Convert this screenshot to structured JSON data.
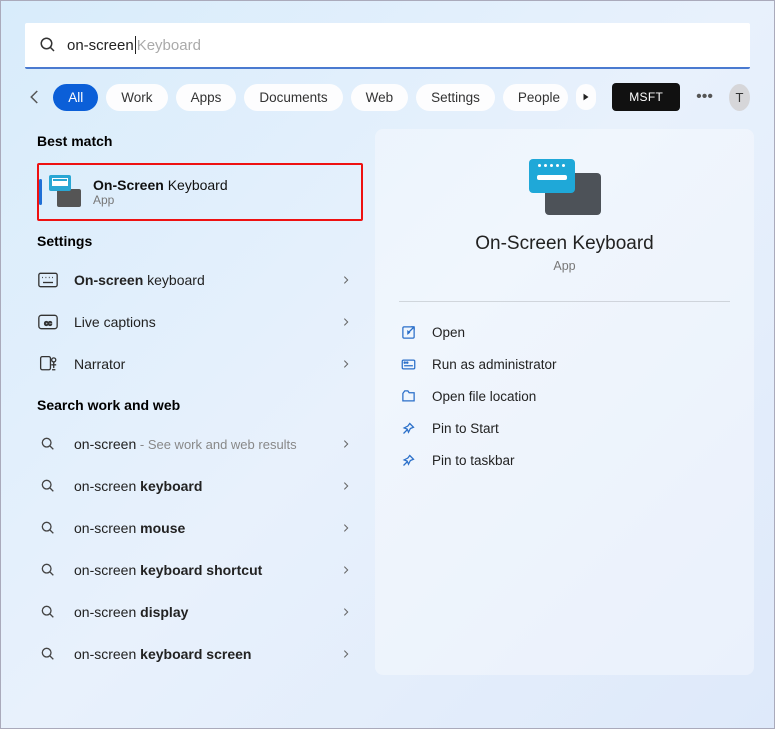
{
  "search": {
    "typed": "on-screen",
    "suggestion": "Keyboard"
  },
  "filters": [
    "All",
    "Work",
    "Apps",
    "Documents",
    "Web",
    "Settings",
    "People"
  ],
  "msft": "MSFT",
  "avatar": "T",
  "sections": {
    "best": "Best match",
    "settings": "Settings",
    "web": "Search work and web"
  },
  "bestMatch": {
    "title_bold": "On-Screen",
    "title_rest": " Keyboard",
    "type": "App"
  },
  "settingsItems": [
    {
      "bold": "On-screen",
      "rest": " keyboard"
    },
    {
      "bold": "",
      "rest": "Live captions"
    },
    {
      "bold": "",
      "rest": "Narrator"
    }
  ],
  "webItems": [
    {
      "pre": "on-screen",
      "bold": "",
      "sub": " - See work and web results"
    },
    {
      "pre": "on-screen ",
      "bold": "keyboard",
      "sub": ""
    },
    {
      "pre": "on-screen ",
      "bold": "mouse",
      "sub": ""
    },
    {
      "pre": "on-screen ",
      "bold": "keyboard shortcut",
      "sub": ""
    },
    {
      "pre": "on-screen ",
      "bold": "display",
      "sub": ""
    },
    {
      "pre": "on-screen ",
      "bold": "keyboard screen",
      "sub": ""
    }
  ],
  "preview": {
    "title": "On-Screen Keyboard",
    "type": "App"
  },
  "actions": [
    "Open",
    "Run as administrator",
    "Open file location",
    "Pin to Start",
    "Pin to taskbar"
  ]
}
